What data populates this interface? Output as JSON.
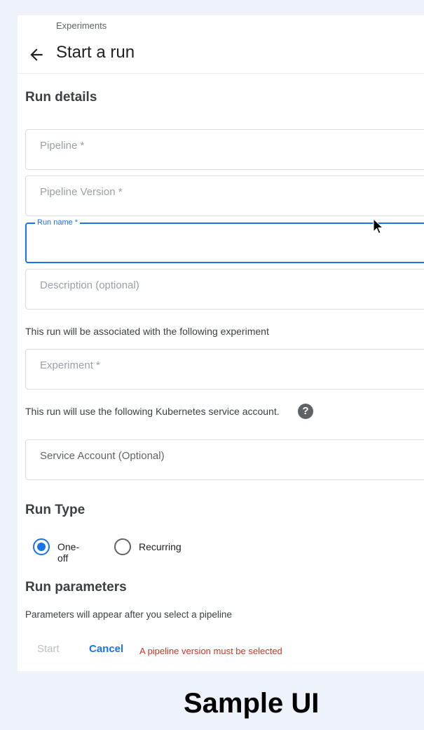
{
  "header": {
    "breadcrumb": "Experiments",
    "title": "Start a run",
    "back_icon": "arrow-left-icon"
  },
  "run_details": {
    "section_title": "Run details",
    "pipeline_placeholder": "Pipeline *",
    "pipeline_version_placeholder": "Pipeline Version *",
    "run_name_label": "Run name *",
    "run_name_value": "",
    "description_placeholder": "Description (optional)",
    "experiment_help": "This run will be associated with the following experiment",
    "experiment_placeholder": "Experiment *",
    "service_account_help": "This run will use the following Kubernetes service account.",
    "help_icon_glyph": "?",
    "service_account_placeholder": "Service Account (Optional)"
  },
  "run_type": {
    "section_title": "Run Type",
    "options": [
      {
        "label": "One-off",
        "selected": true
      },
      {
        "label": "Recurring",
        "selected": false
      }
    ]
  },
  "run_parameters": {
    "section_title": "Run parameters",
    "help": "Parameters will appear after you select a pipeline"
  },
  "actions": {
    "start_label": "Start",
    "cancel_label": "Cancel",
    "error_message": "A pipeline version must be selected"
  },
  "caption": "Sample UI",
  "colors": {
    "accent": "#1a73e8",
    "error": "#d93025",
    "background": "#edf2fb"
  }
}
